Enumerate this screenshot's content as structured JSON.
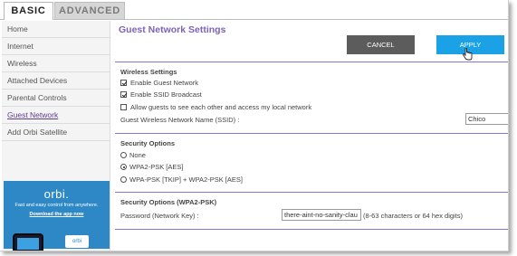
{
  "tabs": {
    "basic": "BASIC",
    "advanced": "ADVANCED"
  },
  "sidebar": {
    "items": [
      {
        "label": "Home"
      },
      {
        "label": "Internet"
      },
      {
        "label": "Wireless"
      },
      {
        "label": "Attached Devices"
      },
      {
        "label": "Parental Controls"
      },
      {
        "label": "Guest Network"
      },
      {
        "label": "Add Orbi Satellite"
      }
    ],
    "active": "Guest Network"
  },
  "promo": {
    "logo": "orbi.",
    "tagline": "Fast and easy control from anywhere.",
    "download": "Download the app now",
    "box_logo": "orbi"
  },
  "page": {
    "title": "Guest Network Settings"
  },
  "buttons": {
    "cancel": "CANCEL",
    "apply": "APPLY"
  },
  "wireless_settings": {
    "title": "Wireless Settings",
    "enable_guest": {
      "label": "Enable Guest Network",
      "checked": true
    },
    "enable_ssid": {
      "label": "Enable SSID Broadcast",
      "checked": true
    },
    "allow_local": {
      "label": "Allow guests to see each other and access my local network",
      "checked": false
    },
    "ssid_label": "Guest Wireless Network Name (SSID) :",
    "ssid_value": "Chico"
  },
  "security_options": {
    "title": "Security Options",
    "options": [
      {
        "label": "None",
        "selected": false
      },
      {
        "label": "WPA2-PSK [AES]",
        "selected": true
      },
      {
        "label": "WPA-PSK [TKIP] + WPA2-PSK [AES]",
        "selected": false
      }
    ]
  },
  "security_wpa2": {
    "title": "Security Options (WPA2-PSK)",
    "password_label": "Password (Network Key) :",
    "password_value": "there-aint-no-sanity-clau",
    "hint": "(8-63 characters or 64 hex digits)"
  },
  "colors": {
    "accent_purple": "#7b63b8",
    "apply_blue": "#1aa1e6",
    "cancel_gray": "#5c5c5c",
    "promo_blue": "#2d88c5"
  }
}
